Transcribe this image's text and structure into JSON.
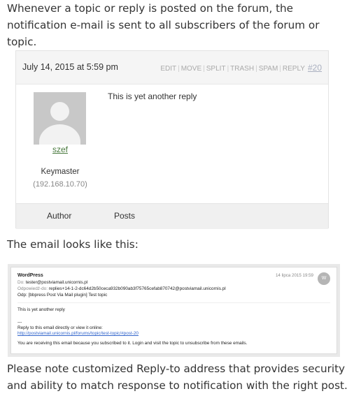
{
  "intro_text": "Whenever a topic or reply is posted on the forum, the notification e-mail is sent to all subscribers of the forum or topic.",
  "forum_reply": {
    "date": "July 14, 2015 at 5:59 pm",
    "admin_links": [
      "EDIT",
      "MOVE",
      "SPLIT",
      "TRASH",
      "SPAM",
      "REPLY"
    ],
    "reply_number": "#20",
    "author_name": "szef",
    "author_role": "Keymaster",
    "author_ip": "(192.168.10.70)",
    "content": "This is yet another reply",
    "footer": {
      "author_label": "Author",
      "posts_label": "Posts"
    }
  },
  "email_intro": "The email looks like this:",
  "email": {
    "from": "WordPress",
    "to_label": "Do:",
    "to": "tester@postviamail.unicornis.pl",
    "reply_to_label": "Odpowiedź-do:",
    "reply_to": "replies+14-1-2-dc64d2b50ceca932b090ab3f75765cefab870742@postviamail.unicornis.pl",
    "subject": "Odp: [bbpress Post Via Mail plugin] Test topic",
    "date": "14 lipca 2015 19:59",
    "avatar_letter": "W",
    "body": "This is yet another reply",
    "separator": "---",
    "reply_line": "Reply to this email directly or view it online:",
    "link": "http://postviamail.unicornis.pl/forums/topic/test-topic/#post-20",
    "footer_note": "You are receiving this email because you subscribed to it. Login and visit the topic to unsubscribe from these emails."
  },
  "closing_text": "Please note customized Reply-to address that provides security and ability to match response to notification with the right post."
}
